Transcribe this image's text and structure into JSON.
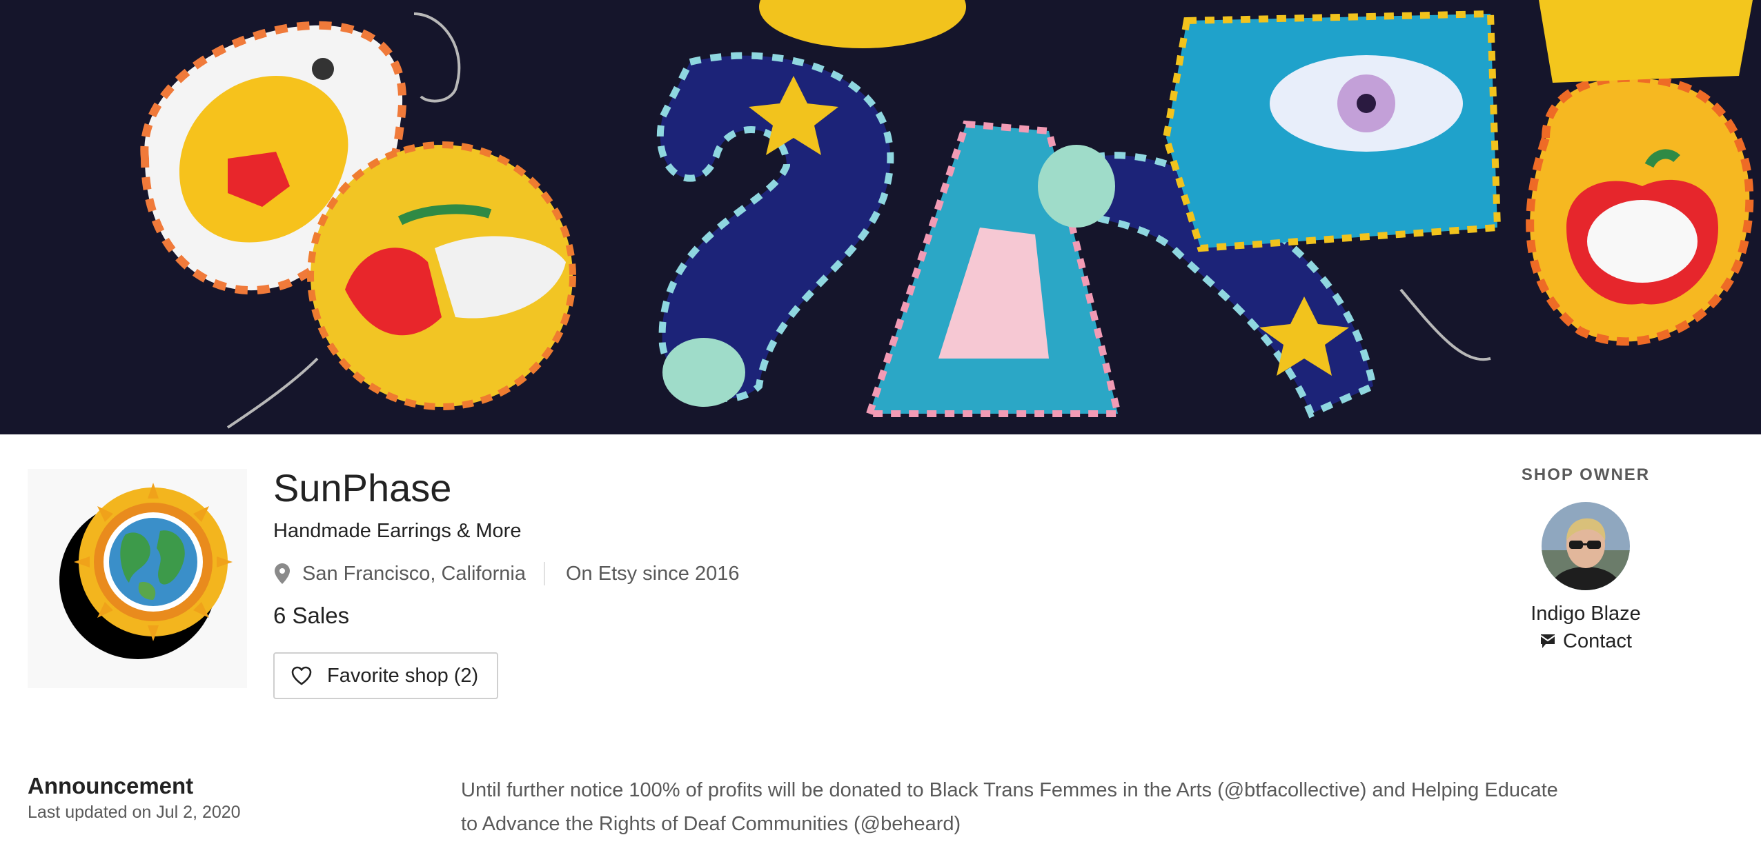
{
  "banner": {
    "alt": "Handmade felt earrings banner"
  },
  "shop": {
    "logo_icon": "sun-globe-logo",
    "name": "SunPhase",
    "tagline": "Handmade Earrings & More",
    "location_icon": "map-pin-icon",
    "location": "San Francisco, California",
    "since": "On Etsy since 2016",
    "sales": "6 Sales",
    "favorite_icon": "heart-icon",
    "favorite_label": "Favorite shop (2)"
  },
  "owner": {
    "heading": "SHOP OWNER",
    "name": "Indigo Blaze",
    "contact_icon": "message-icon",
    "contact_label": "Contact"
  },
  "announcement": {
    "title": "Announcement",
    "updated": "Last updated on Jul 2, 2020",
    "text": "Until further notice 100% of profits will be donated to Black Trans Femmes in the Arts (@btfacollective) and Helping Educate to Advance the Rights of Deaf Communities (@beheard)"
  },
  "colors": {
    "text_primary": "#222222",
    "text_secondary": "#595959",
    "border": "#cfcfcf",
    "banner_bg": "#13142a"
  }
}
